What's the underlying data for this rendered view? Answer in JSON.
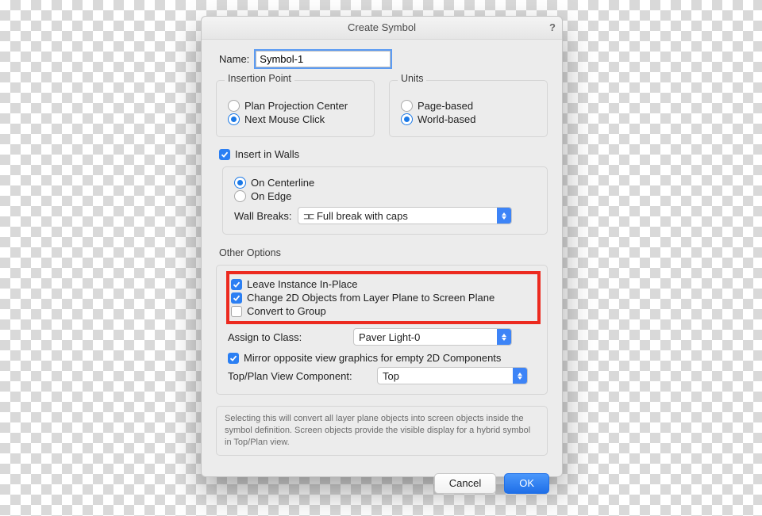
{
  "dialog": {
    "title": "Create Symbol",
    "help": "?",
    "name_label": "Name:",
    "name_value": "Symbol-1",
    "insertion": {
      "title": "Insertion Point",
      "plan": "Plan Projection Center",
      "next": "Next Mouse Click"
    },
    "units": {
      "title": "Units",
      "page": "Page-based",
      "world": "World-based"
    },
    "insert_walls": "Insert in Walls",
    "centerline": "On Centerline",
    "edge": "On Edge",
    "wall_breaks_label": "Wall Breaks:",
    "wall_breaks_value": "Full break with caps",
    "other_title": "Other Options",
    "leave_instance": "Leave Instance In-Place",
    "change_2d": "Change 2D Objects from Layer Plane to Screen Plane",
    "convert_group": "Convert to Group",
    "assign_class_label": "Assign to Class:",
    "assign_class_value": "Paver Light-0",
    "mirror": "Mirror opposite view graphics for empty 2D Components",
    "top_plan_label": "Top/Plan View Component:",
    "top_plan_value": "Top",
    "info": "Selecting this will convert all layer plane objects into screen objects inside the symbol definition.  Screen objects provide the visible display for a hybrid symbol in Top/Plan view.",
    "cancel": "Cancel",
    "ok": "OK"
  }
}
